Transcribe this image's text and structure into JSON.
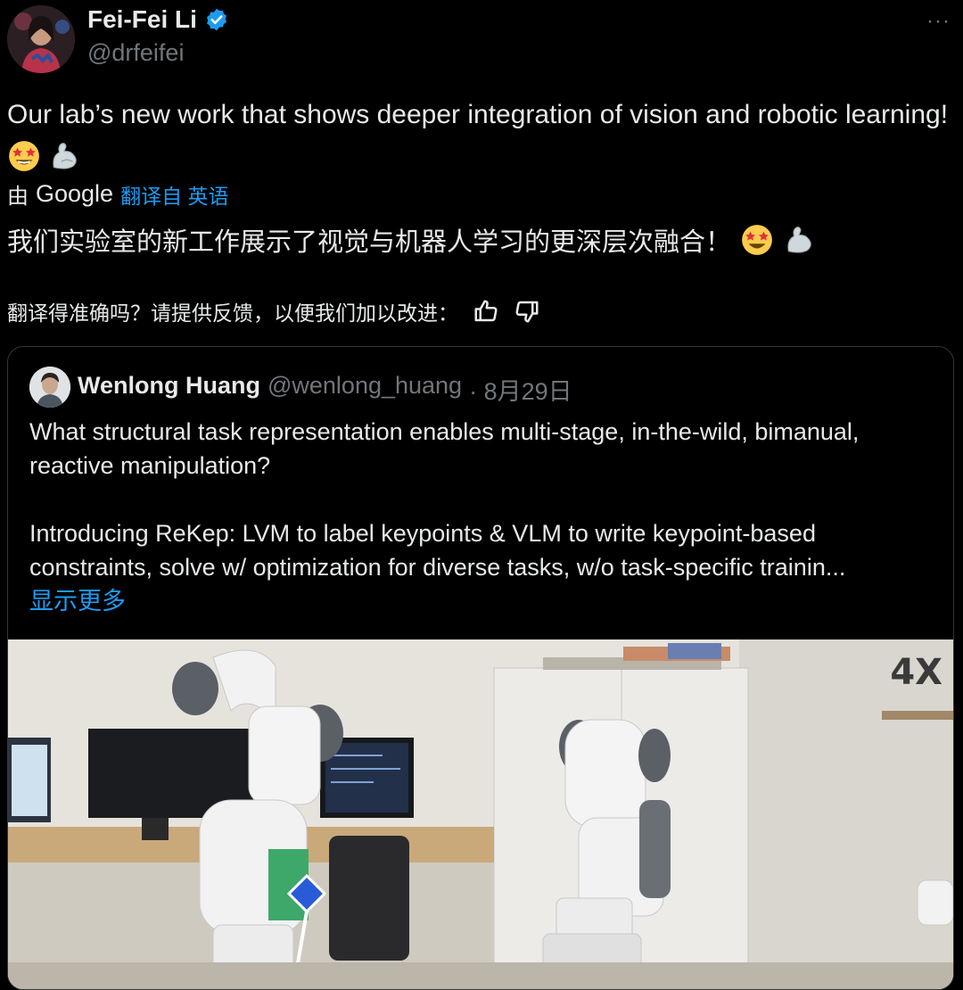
{
  "author": {
    "name": "Fei-Fei Li",
    "handle": "@drfeifei",
    "verified_color": "#1d9bf0"
  },
  "more_icon": "···",
  "tweet": {
    "text": "Our lab’s new work that shows deeper integration of vision and robotic learning!",
    "emojis": [
      "star-struck-emoji",
      "flexed-biceps-emoji"
    ]
  },
  "translation": {
    "by_label": "由",
    "provider": "Google",
    "link_text": "翻译自 英语",
    "translated_text": "我们实验室的新工作展示了视觉与机器人学习的更深层次融合！",
    "feedback_prompt": "翻译得准确吗？请提供反馈，以便我们加以改进："
  },
  "quote": {
    "name": "Wenlong Huang",
    "handle": "@wenlong_huang",
    "date": "· 8月29日",
    "paragraph1": "What structural task representation enables multi-stage, in-the-wild, bimanual, reactive manipulation?",
    "paragraph2": "Introducing ReKep: LVM to label keypoints & VLM to write keypoint-based constraints, solve w/ optimization for diverse tasks, w/o task-specific trainin...",
    "show_more": "显示更多",
    "media": {
      "speed_label": "4X"
    }
  },
  "colors": {
    "background": "#000000",
    "text": "#e7e9ea",
    "secondary": "#71767b",
    "link": "#1d9bf0",
    "border": "#333639"
  }
}
